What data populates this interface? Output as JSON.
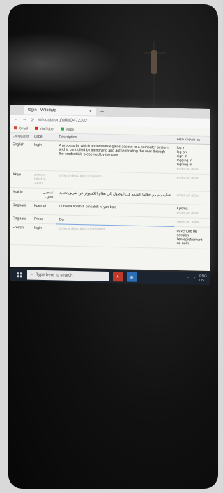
{
  "browser": {
    "tab_title": "login - Wikidata",
    "tab_close": "×",
    "new_tab": "+",
    "url": "wikidata.org/wiki/Q472302"
  },
  "bookmarks": [
    "Gmail",
    "YouTube",
    "Maps"
  ],
  "table": {
    "headers": [
      "Language",
      "Label",
      "Description",
      "Also known as"
    ],
    "rows": [
      {
        "language": "English",
        "label": "login",
        "description": "A process by which an individual gains access to a computer system and is controlled by identifying and authenticating the user through the credentials presented by the user",
        "aka": [
          "log in",
          "log on",
          "sign in",
          "logging in",
          "signing in",
          "enter an alias"
        ]
      },
      {
        "language": "Akan",
        "label": "enter a label in Akan",
        "description": "enter a description in Akan",
        "aka": [
          "enter an alias"
        ]
      },
      {
        "language": "Arabic",
        "label": "تسجيل دخول",
        "description": "عملية يتم من خلالها التحكم في الوصول إلى نظام الكمبيوتر عن طريق تحديد",
        "aka": [
          "enter an alias"
        ]
      },
      {
        "language": "Dagbani",
        "label": "kpemgi",
        "description": "Di nyela so'shɛli binsabili ni yɛn bɔlɛ",
        "aka": [
          "Kpɛma",
          "enter an alias"
        ]
      },
      {
        "language": "Dagaare",
        "label": "Pieso",
        "description": "Da",
        "aka": [
          "enter an alias"
        ]
      },
      {
        "language": "French",
        "label": "login",
        "description": "enter a description in French",
        "aka": [
          "ouverture de session",
          "l'enregistrement de nom"
        ]
      }
    ]
  },
  "taskbar": {
    "search_placeholder": "Type here to search",
    "tray_lang": "ENG",
    "tray_region": "US"
  }
}
